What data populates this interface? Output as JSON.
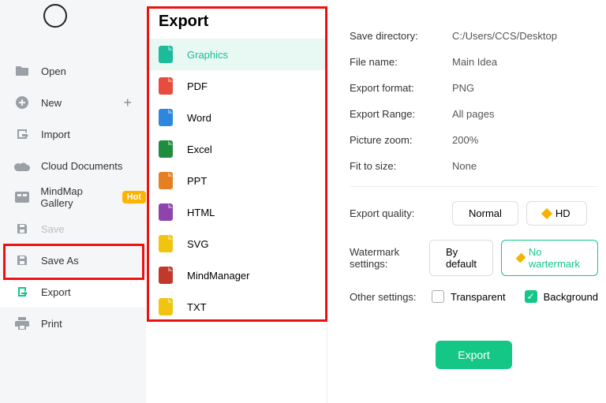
{
  "sidebar": {
    "items": [
      {
        "label": "Open",
        "icon": "folder"
      },
      {
        "label": "New",
        "icon": "plus-circle",
        "plus": true
      },
      {
        "label": "Import",
        "icon": "import"
      },
      {
        "label": "Cloud Documents",
        "icon": "cloud"
      },
      {
        "label": "MindMap Gallery",
        "icon": "gallery",
        "badge": "Hot"
      },
      {
        "label": "Save",
        "icon": "save",
        "disabled": true
      },
      {
        "label": "Save As",
        "icon": "save-as"
      },
      {
        "label": "Export",
        "icon": "export",
        "selected": true
      },
      {
        "label": "Print",
        "icon": "print"
      }
    ]
  },
  "formats": {
    "title": "Export",
    "items": [
      {
        "label": "Graphics",
        "color": "c-teal",
        "active": true
      },
      {
        "label": "PDF",
        "color": "c-red"
      },
      {
        "label": "Word",
        "color": "c-blue"
      },
      {
        "label": "Excel",
        "color": "c-green"
      },
      {
        "label": "PPT",
        "color": "c-orange"
      },
      {
        "label": "HTML",
        "color": "c-purple"
      },
      {
        "label": "SVG",
        "color": "c-amber"
      },
      {
        "label": "MindManager",
        "color": "c-dred"
      },
      {
        "label": "TXT",
        "color": "c-amber"
      }
    ]
  },
  "settings": {
    "save_directory_label": "Save directory:",
    "save_directory": "C:/Users/CCS/Desktop",
    "file_name_label": "File name:",
    "file_name": "Main Idea",
    "export_format_label": "Export format:",
    "export_format": "PNG",
    "export_range_label": "Export Range:",
    "export_range": "All pages",
    "picture_zoom_label": "Picture zoom:",
    "picture_zoom": "200%",
    "fit_to_size_label": "Fit to size:",
    "fit_to_size": "None",
    "export_quality_label": "Export quality:",
    "quality_normal": "Normal",
    "quality_hd": "HD",
    "watermark_label": "Watermark settings:",
    "watermark_default": "By default",
    "watermark_none": "No wartermark",
    "other_label": "Other settings:",
    "transparent": "Transparent",
    "background": "Background",
    "export_btn": "Export"
  }
}
